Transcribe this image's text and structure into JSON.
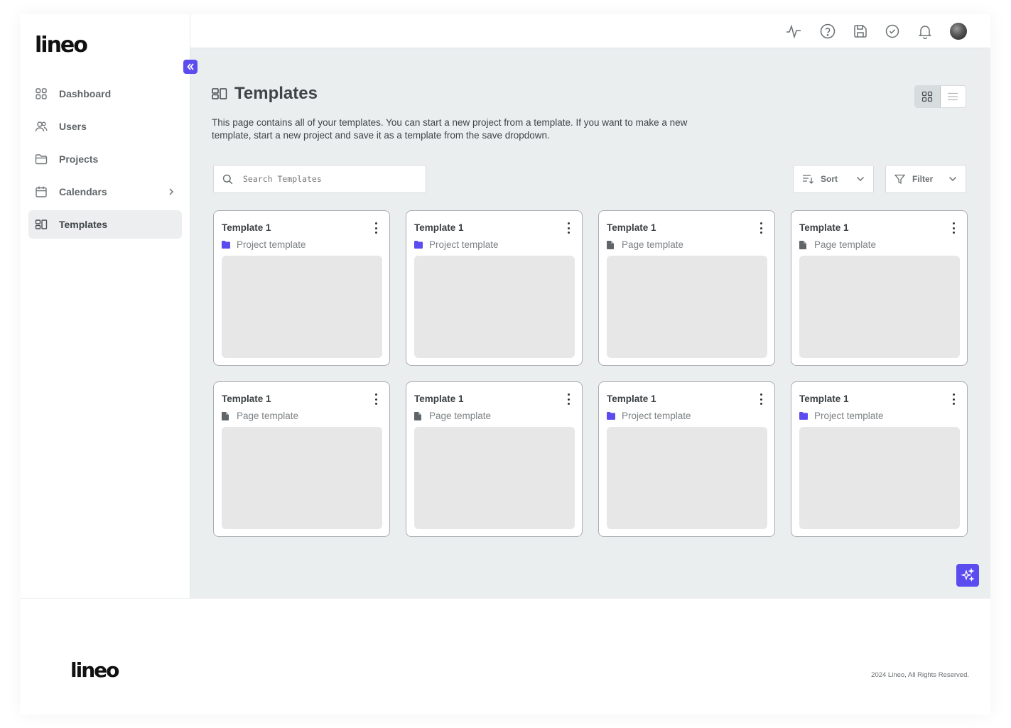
{
  "app": {
    "logo": "lineo"
  },
  "sidebar": {
    "collapse_icon": "chevrons-left-icon",
    "items": [
      {
        "label": "Dashboard",
        "icon": "grid-icon",
        "active": false
      },
      {
        "label": "Users",
        "icon": "users-icon",
        "active": false
      },
      {
        "label": "Projects",
        "icon": "folder-icon",
        "active": false
      },
      {
        "label": "Calendars",
        "icon": "calendar-icon",
        "active": false,
        "has_submenu": true
      },
      {
        "label": "Templates",
        "icon": "templates-icon",
        "active": true
      }
    ]
  },
  "topbar": {
    "icons": [
      "activity-icon",
      "help-icon",
      "save-icon",
      "check-circle-icon",
      "bell-icon"
    ],
    "avatar": "user-avatar"
  },
  "page": {
    "title": "Templates",
    "description": "This page contains all of your templates. You can start a new project from a template. If you want to make a new template, start a new project and save it as a template from the save dropdown.",
    "view_modes": [
      "grid",
      "list"
    ],
    "active_view": "grid"
  },
  "search": {
    "placeholder": "Search Templates",
    "value": ""
  },
  "sort": {
    "label": "Sort"
  },
  "filter": {
    "label": "Filter"
  },
  "templates": [
    {
      "title": "Template 1",
      "type": "Project template",
      "icon": "folder-icon"
    },
    {
      "title": "Template 1",
      "type": "Project template",
      "icon": "folder-icon"
    },
    {
      "title": "Template 1",
      "type": "Page template",
      "icon": "file-icon"
    },
    {
      "title": "Template 1",
      "type": "Page template",
      "icon": "file-icon"
    },
    {
      "title": "Template 1",
      "type": "Page template",
      "icon": "file-icon"
    },
    {
      "title": "Template 1",
      "type": "Page template",
      "icon": "file-icon"
    },
    {
      "title": "Template 1",
      "type": "Project template",
      "icon": "folder-icon"
    },
    {
      "title": "Template 1",
      "type": "Project template",
      "icon": "folder-icon"
    }
  ],
  "colors": {
    "accent": "#5b4cf0",
    "background": "#ebeeef",
    "active_nav": "#eceeef"
  },
  "footer": {
    "logo": "lineo",
    "copyright": "2024 Lineo, All Rights Reserved."
  }
}
